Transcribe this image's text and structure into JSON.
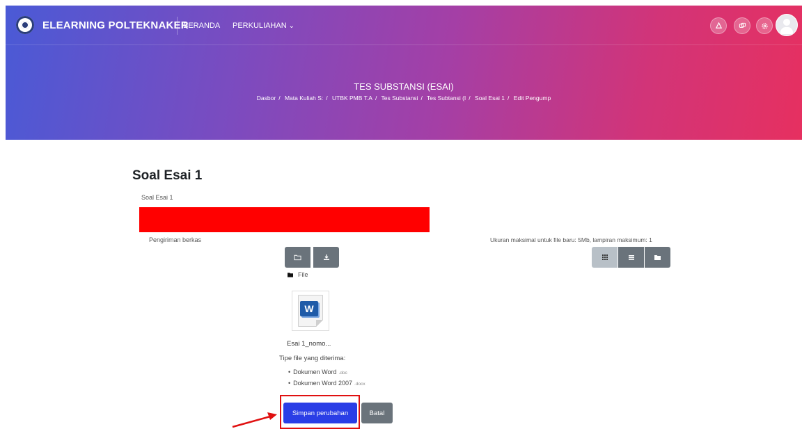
{
  "navbar": {
    "brand": "ELEARNING POLTEKNAKER",
    "items": [
      {
        "label": "BERANDA"
      },
      {
        "label": "PERKULIAHAN",
        "icon": "chevron-down-icon"
      }
    ],
    "icons": [
      "notification-icon",
      "messages-icon",
      "settings-icon",
      "avatar"
    ]
  },
  "banner": {
    "title": "TES SUBSTANSI (ESAI)",
    "breadcrumb": [
      "Dasbor",
      "Mata Kuliah S:",
      "UTBK PMB T.A",
      "Tes Substansi",
      "Tes Subtansi (I",
      "Soal Esai 1",
      "Edit Pengump"
    ]
  },
  "main": {
    "heading": "Soal Esai 1",
    "question_label": "Soal Esai 1",
    "submission_label": "Pengiriman berkas",
    "max_info": "Ukuran maksimal untuk file baru: 5Mb, lampiran maksimum: 1",
    "folder_label": "File",
    "file_name": "Esai 1_nomo...",
    "accepted_title": "Tipe file yang diterima:",
    "accepted_types": [
      {
        "name": "Dokumen Word",
        "ext": ".doc"
      },
      {
        "name": "Dokumen Word 2007",
        "ext": ".docx"
      }
    ],
    "save_label": "Simpan perubahan",
    "cancel_label": "Batal"
  },
  "colors": {
    "primary_button": "#2a3ee6",
    "secondary_button": "#6a737b",
    "highlight": "#e01010",
    "redaction": "#ff0000"
  }
}
